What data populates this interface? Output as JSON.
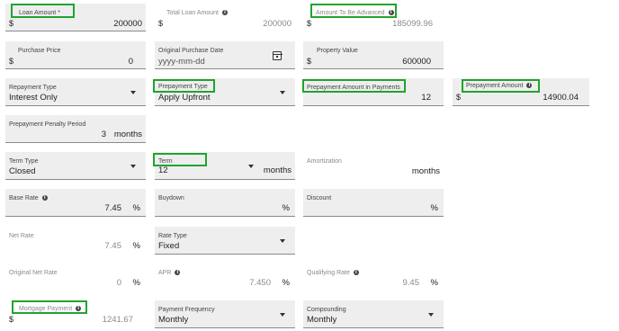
{
  "loan_amount": {
    "label": "Loan Amount *",
    "currency": "$",
    "value": "200000"
  },
  "total_loan_amount": {
    "label": "Total Loan Amount",
    "currency": "$",
    "value": "200000"
  },
  "amount_to_be_advanced": {
    "label": "Amount To Be Advanced",
    "currency": "$",
    "value": "185099.96"
  },
  "purchase_price": {
    "label": "Purchase Price",
    "currency": "$",
    "value": "0"
  },
  "original_purchase_date": {
    "label": "Original Purchase Date",
    "placeholder": "yyyy-mm-dd"
  },
  "property_value": {
    "label": "Property Value",
    "currency": "$",
    "value": "600000"
  },
  "repayment_type": {
    "label": "Repayment Type",
    "value": "Interest Only"
  },
  "prepayment_type": {
    "label": "Prepayment Type",
    "value": "Apply Upfront"
  },
  "prepayment_amount_in_payments": {
    "label": "Prepayment Amount in Payments",
    "value": "12"
  },
  "prepayment_amount": {
    "label": "Prepayment Amount",
    "currency": "$",
    "value": "14900.04"
  },
  "prepayment_penalty_period": {
    "label": "Prepayment Penalty Period",
    "value": "3",
    "unit": "months"
  },
  "term_type": {
    "label": "Term Type",
    "value": "Closed"
  },
  "term": {
    "label": "Term",
    "value": "12",
    "unit": "months"
  },
  "amortization": {
    "label": "Amortization",
    "value": "",
    "unit": "months"
  },
  "base_rate": {
    "label": "Base Rate",
    "value": "7.45",
    "unit": "%"
  },
  "buydown": {
    "label": "Buydown",
    "value": "",
    "unit": "%"
  },
  "discount": {
    "label": "Discount",
    "value": "",
    "unit": "%"
  },
  "net_rate": {
    "label": "Net Rate",
    "value": "7.45",
    "unit": "%"
  },
  "rate_type": {
    "label": "Rate Type",
    "value": "Fixed"
  },
  "original_net_rate": {
    "label": "Original Net Rate",
    "value": "0",
    "unit": "%"
  },
  "apr": {
    "label": "APR",
    "value": "7.450",
    "unit": "%"
  },
  "qualifying_rate": {
    "label": "Qualifying Rate",
    "value": "9.45",
    "unit": "%"
  },
  "mortgage_payment": {
    "label": "Mortgage Payment",
    "currency": "$",
    "value": "1241.67"
  },
  "payment_frequency": {
    "label": "Payment Frequency",
    "value": "Monthly"
  },
  "compounding": {
    "label": "Compounding",
    "value": "Monthly"
  },
  "icons": {
    "info": "info-icon",
    "calendar": "calendar-icon",
    "dropdown": "chevron-down-icon"
  },
  "colors": {
    "highlight": "#1fa52e",
    "field_bg": "#eeeeee",
    "disabled_text": "#8a8a8a"
  }
}
